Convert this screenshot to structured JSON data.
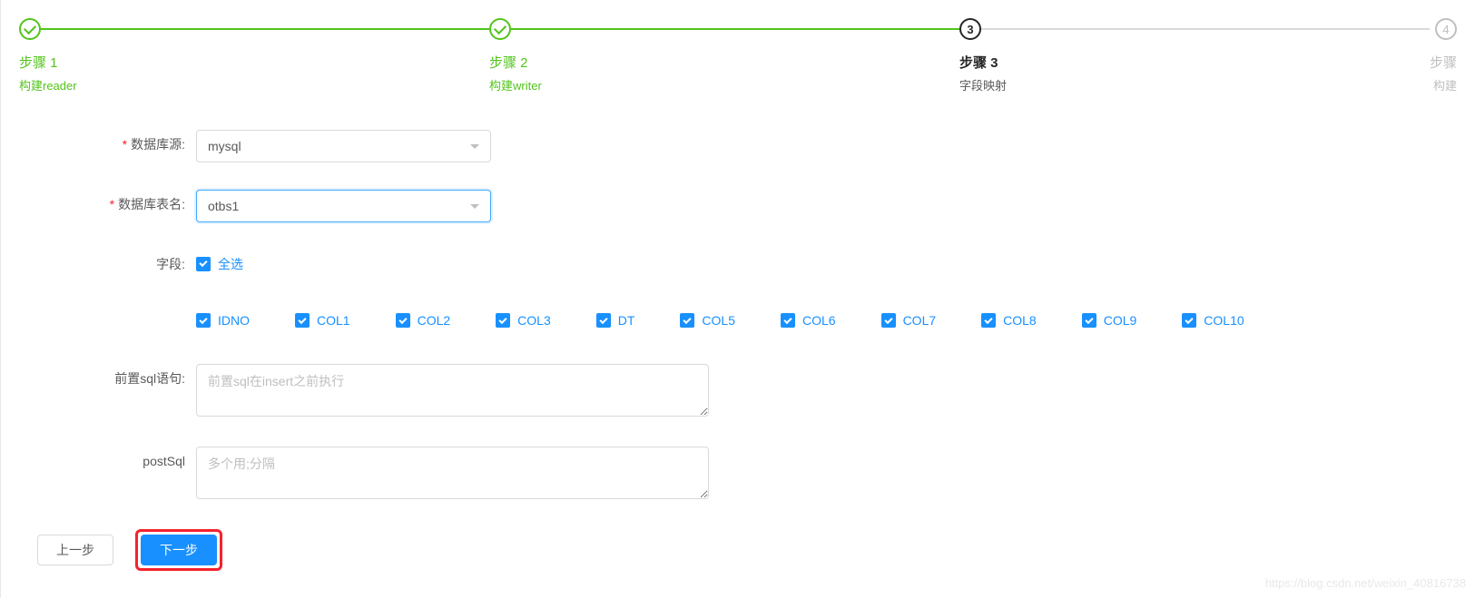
{
  "steps": [
    {
      "title": "步骤 1",
      "sub": "构建reader",
      "state": "done"
    },
    {
      "title": "步骤 2",
      "sub": "构建writer",
      "state": "done"
    },
    {
      "title": "步骤 3",
      "sub": "字段映射",
      "state": "current",
      "num": "3"
    },
    {
      "title": "步骤",
      "sub": "构建",
      "state": "inactive",
      "num": "4"
    }
  ],
  "form": {
    "datasource_label": "数据库源:",
    "datasource_value": "mysql",
    "table_label": "数据库表名:",
    "table_value": "otbs1",
    "fields_label": "字段:",
    "select_all_label": "全选",
    "select_all_checked": true,
    "columns": [
      {
        "name": "IDNO",
        "checked": true
      },
      {
        "name": "COL1",
        "checked": true
      },
      {
        "name": "COL2",
        "checked": true
      },
      {
        "name": "COL3",
        "checked": true
      },
      {
        "name": "DT",
        "checked": true
      },
      {
        "name": "COL5",
        "checked": true
      },
      {
        "name": "COL6",
        "checked": true
      },
      {
        "name": "COL7",
        "checked": true
      },
      {
        "name": "COL8",
        "checked": true
      },
      {
        "name": "COL9",
        "checked": true
      },
      {
        "name": "COL10",
        "checked": true
      }
    ],
    "presql_label": "前置sql语句:",
    "presql_placeholder": "前置sql在insert之前执行",
    "presql_value": "",
    "postsql_label": "postSql",
    "postsql_placeholder": "多个用;分隔",
    "postsql_value": ""
  },
  "actions": {
    "prev": "上一步",
    "next": "下一步"
  },
  "watermark": "https://blog.csdn.net/weixin_40816738"
}
